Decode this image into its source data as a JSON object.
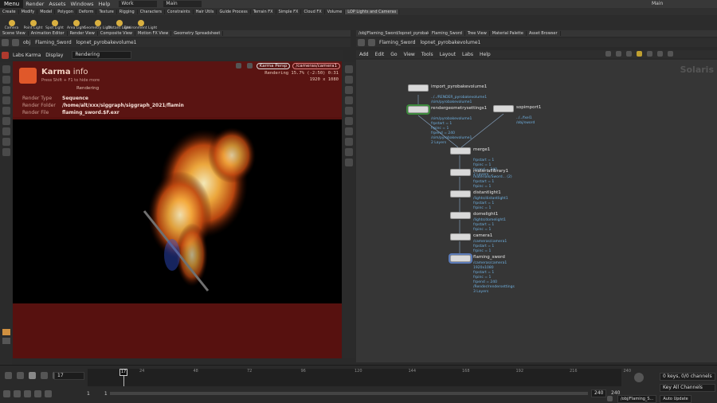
{
  "menubar": {
    "menu": "Menu",
    "items": [
      "Render",
      "Assets",
      "Windows",
      "Help"
    ],
    "desktop": "Work",
    "scene": "Main",
    "right_scene": "Main"
  },
  "shelf_tabs": [
    "Create",
    "Modify",
    "Model",
    "Polygon",
    "Deform",
    "Texture",
    "Rigging",
    "Characters",
    "Constraints",
    "Hair Utils",
    "Guide Process",
    "Terrain FX",
    "Simple FX",
    "Cloud FX",
    "Volume",
    "LOP Lights and Cameras"
  ],
  "shelf_tools": [
    "Camera",
    "Point Light",
    "Spot Light",
    "Area Light",
    "Geometry Light",
    "Distant Light",
    "Environment Light"
  ],
  "pane_tabs_left": [
    "Scene View",
    "Animation Editor",
    "Render View",
    "Composite View",
    "Motion FX View",
    "Geometry Spreadsheet"
  ],
  "pane_tabs_right": [
    "/obj/Flaming_Sword/lopnet_pyrobakevolume1",
    "Flaming_Sword",
    "Tree View",
    "Material Palette",
    "Asset Browser"
  ],
  "path_left": {
    "root": "obj",
    "node": "Flaming_Sword",
    "sub": "lopnet_pyrobakevolume1"
  },
  "path_right": {
    "node": "Flaming_Sword",
    "sub": "lopnet_pyrobakevolume1"
  },
  "viewport": {
    "renderer": "Labs Karma",
    "display": "Display",
    "status": "Rendering",
    "camera_persp": "Karma Persp",
    "camera_path": "/cameras/camera1",
    "render_progress": "Rendering  15.7%  (-2:50)  0:31",
    "resolution": "1920 x 1080",
    "info_title_a": "Karma",
    "info_title_b": " info",
    "info_sub": "Press Shift + F1 to hide more",
    "info_state": "Rendering",
    "rows": [
      {
        "k": "Render Type",
        "v": "Sequence"
      },
      {
        "k": "Render Folder",
        "v": "/home/alt/xxx/siggraph/siggraph_2021/flamin"
      },
      {
        "k": "Render File",
        "v": "flaming_sword.$F.exr"
      }
    ]
  },
  "net_menu": [
    "Add",
    "Edit",
    "Go",
    "View",
    "Tools",
    "Layout",
    "Labs",
    "Help"
  ],
  "net_title": "Solaris",
  "nodes": [
    {
      "id": "import",
      "name": "import_pyrobakevolume1",
      "info": "../../RENDER_pyrobakevolume1\n/sim/pyrobakevolume1"
    },
    {
      "id": "rgs",
      "name": "rendergeometrysettings1",
      "info": "/sim/pyrobakevolume1\nfrpstart = 1\nfrpinc = 1\nfrpend = 240\n/sim/pyrobakevolume1\n2 Layers"
    },
    {
      "id": "sop",
      "name": "sopimport1",
      "info": "../../fxel1\n/obj/sword"
    },
    {
      "id": "merge",
      "name": "merge1",
      "info": "frpstart = 1\nfrpinc = 1\nfrpend = 240\n2 Layers"
    },
    {
      "id": "mat",
      "name": "materiallibrary1",
      "info": "materials/Sword... (2)\nfrpstart = 1\nfrpinc = 1"
    },
    {
      "id": "dist",
      "name": "distantlight1",
      "info": "/lights/distantlight1\nfrpstart = 1\nfrpinc = 1"
    },
    {
      "id": "dome",
      "name": "domelight1",
      "info": "/lights/domelight1\nfrpstart = 1\nfrpinc = 1"
    },
    {
      "id": "cam",
      "name": "camera1",
      "info": "/cameras/camera1\nfrpstart = 1\nfrpinc = 1"
    },
    {
      "id": "flame",
      "name": "flaming_sword",
      "info": "/cameras/camera1\n1920x1080\nfrpstart = 1\nfrpinc = 1\nfrpend = 240\n/Render/rendersettings\n3 Layers"
    }
  ],
  "timeline": {
    "frame": "17",
    "current": "17",
    "ticks": [
      "24",
      "48",
      "72",
      "96",
      "120",
      "144",
      "168",
      "192",
      "216",
      "240"
    ],
    "start": "1",
    "start2": "1",
    "end": "240",
    "end2": "240"
  },
  "right_panel": {
    "keys": "0 keys, 0/0 channels",
    "all_channels": "Key All Channels"
  },
  "status": {
    "path": "/obj/Flaming_S...",
    "update": "Auto Update"
  },
  "colors": {
    "accent": "#e0a030",
    "render_bg": "#5a1412",
    "flame": "#f0a030"
  }
}
